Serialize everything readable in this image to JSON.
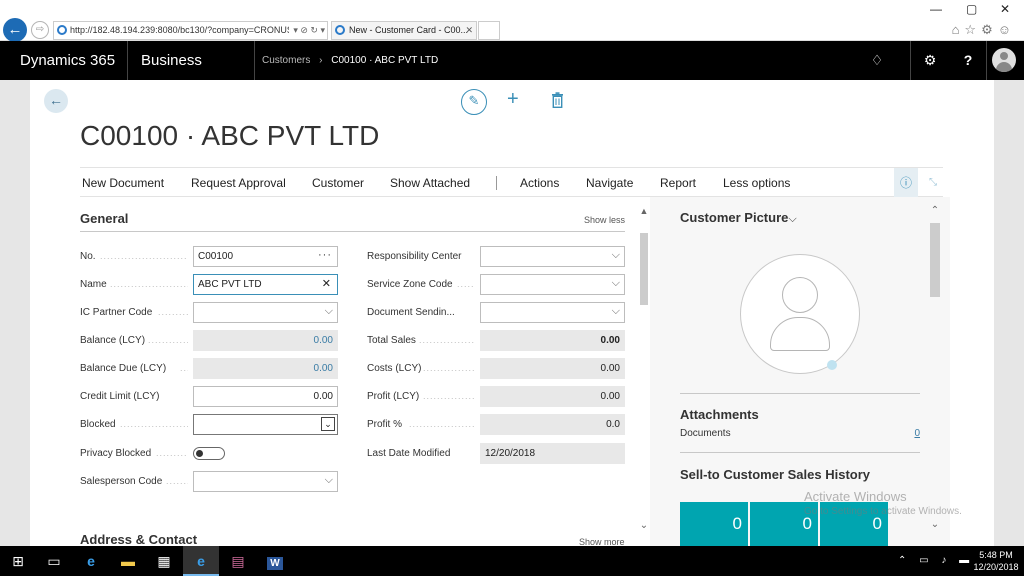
{
  "browser": {
    "address": "http://182.48.194.239:8080/bc130/?company=CRONUS",
    "tab_title": "New - Customer Card - C00...",
    "tab_close": "✕",
    "win_min": "—",
    "win_max": "▢",
    "win_close": "✕",
    "back_icon": "←",
    "fwd_icon": "⇨",
    "addr_tools": "▾ ⊘ ↻ ▾",
    "icons_text": "⌂☆⚙☺"
  },
  "topbar": {
    "brand": "Dynamics 365",
    "product": "Business Central",
    "breadcrumb_parent": "Customers",
    "breadcrumb_sep": "›",
    "breadcrumb_current": "C00100 · ABC PVT LTD",
    "lightbulb_icon": "♢",
    "settings_icon": "⚙",
    "help_label": "?"
  },
  "card": {
    "back_icon": "←",
    "edit_icon": "✎",
    "new_icon": "+",
    "title": "C00100 · ABC PVT LTD"
  },
  "actions": {
    "new_document": "New Document",
    "request_approval": "Request Approval",
    "customer": "Customer",
    "show_attached": "Show Attached",
    "actions": "Actions",
    "navigate": "Navigate",
    "report": "Report",
    "less_options": "Less options",
    "info_icon": "ⓘ",
    "collapse_icon": "⤡"
  },
  "general": {
    "title": "General",
    "show_less": "Show less",
    "fields_left": [
      {
        "label": "No.",
        "value": "C00100"
      },
      {
        "label": "Name",
        "value": "ABC PVT LTD"
      },
      {
        "label": "IC Partner Code",
        "value": ""
      },
      {
        "label": "Balance (LCY)",
        "value": "0.00"
      },
      {
        "label": "Balance Due (LCY)",
        "value": "0.00"
      },
      {
        "label": "Credit Limit (LCY)",
        "value": "0.00"
      },
      {
        "label": "Blocked",
        "value": ""
      },
      {
        "label": "Privacy Blocked",
        "value": ""
      },
      {
        "label": "Salesperson Code",
        "value": ""
      }
    ],
    "fields_right": [
      {
        "label": "Responsibility Center",
        "value": ""
      },
      {
        "label": "Service Zone Code",
        "value": ""
      },
      {
        "label": "Document Sendin...",
        "value": ""
      },
      {
        "label": "Total Sales",
        "value": "0.00"
      },
      {
        "label": "Costs (LCY)",
        "value": "0.00"
      },
      {
        "label": "Profit (LCY)",
        "value": "0.00"
      },
      {
        "label": "Profit %",
        "value": "0.0"
      },
      {
        "label": "Last Date Modified",
        "value": "12/20/2018"
      }
    ],
    "dropdown_icon": "⌵",
    "lookup_icon": "···",
    "clear_icon": "✕",
    "blocked_chevron": "⌄",
    "dots": ".............................."
  },
  "address": {
    "title": "Address & Contact",
    "show_more": "Show more"
  },
  "factbox": {
    "picture_title": "Customer Picture",
    "picture_chevron": "⌵",
    "attachments_title": "Attachments",
    "documents_label": "Documents",
    "documents_value": "0",
    "sales_history_title": "Sell-to Customer Sales History",
    "cues": [
      "0",
      "0",
      "0"
    ]
  },
  "scroll": {
    "up": "▲",
    "down": "▼",
    "right_up": "⌃",
    "right_down": "⌄"
  },
  "watermark": {
    "line1": "Activate Windows",
    "line2": "Go to Settings to activate Windows."
  },
  "taskbar": {
    "start_icon": "⊞",
    "taskview_icon": "▭",
    "edge_icon": "e",
    "explorer_icon": "▬",
    "store_icon": "▦",
    "ie_icon": "e",
    "app_icon": "▤",
    "word_icon": "W",
    "tray_icons": "⌃ ▭ ♪ ▬",
    "time": "5:48 PM",
    "date": "12/20/2018",
    "notification_icon": "▭"
  }
}
